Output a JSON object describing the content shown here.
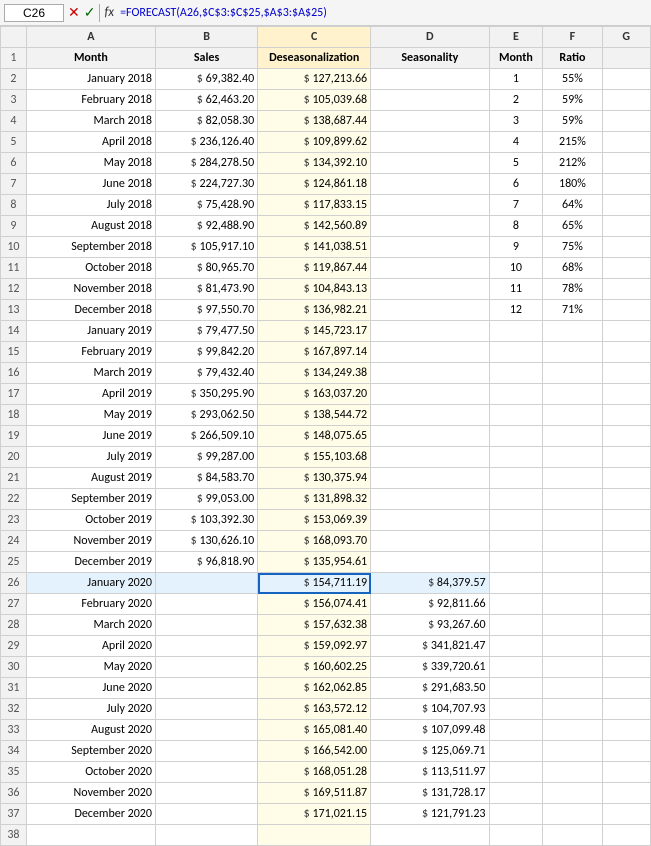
{
  "formulaBar": {
    "cellRef": "C26",
    "formula": "=FORECAST(A26,$C$3:$C$25,$A$3:$A$25)"
  },
  "columns": {
    "headers": [
      "",
      "A",
      "B",
      "C",
      "D",
      "E",
      "F",
      "G"
    ]
  },
  "rows": [
    {
      "rowNum": "1",
      "a": "Month",
      "b": "Sales",
      "c": "Deseasonalization",
      "d": "Seasonality",
      "e": "Month",
      "f": "Ratio",
      "g": ""
    },
    {
      "rowNum": "2",
      "a": "January 2018",
      "b_dollar": "$",
      "b_val": "69,382.40",
      "c_dollar": "$",
      "c_val": "127,213.66",
      "d": "",
      "e": "1",
      "f": "55%",
      "g": ""
    },
    {
      "rowNum": "3",
      "a": "February 2018",
      "b_dollar": "$",
      "b_val": "62,463.20",
      "c_dollar": "$",
      "c_val": "105,039.68",
      "d": "",
      "e": "2",
      "f": "59%",
      "g": ""
    },
    {
      "rowNum": "4",
      "a": "March 2018",
      "b_dollar": "$",
      "b_val": "82,058.30",
      "c_dollar": "$",
      "c_val": "138,687.44",
      "d": "",
      "e": "3",
      "f": "59%",
      "g": ""
    },
    {
      "rowNum": "5",
      "a": "April 2018",
      "b_dollar": "$",
      "b_val": "236,126.40",
      "c_dollar": "$",
      "c_val": "109,899.62",
      "d": "",
      "e": "4",
      "f": "215%",
      "g": ""
    },
    {
      "rowNum": "6",
      "a": "May 2018",
      "b_dollar": "$",
      "b_val": "284,278.50",
      "c_dollar": "$",
      "c_val": "134,392.10",
      "d": "",
      "e": "5",
      "f": "212%",
      "g": ""
    },
    {
      "rowNum": "7",
      "a": "June 2018",
      "b_dollar": "$",
      "b_val": "224,727.30",
      "c_dollar": "$",
      "c_val": "124,861.18",
      "d": "",
      "e": "6",
      "f": "180%",
      "g": ""
    },
    {
      "rowNum": "8",
      "a": "July 2018",
      "b_dollar": "$",
      "b_val": "75,428.90",
      "c_dollar": "$",
      "c_val": "117,833.15",
      "d": "",
      "e": "7",
      "f": "64%",
      "g": ""
    },
    {
      "rowNum": "9",
      "a": "August 2018",
      "b_dollar": "$",
      "b_val": "92,488.90",
      "c_dollar": "$",
      "c_val": "142,560.89",
      "d": "",
      "e": "8",
      "f": "65%",
      "g": ""
    },
    {
      "rowNum": "10",
      "a": "September 2018",
      "b_dollar": "$",
      "b_val": "105,917.10",
      "c_dollar": "$",
      "c_val": "141,038.51",
      "d": "",
      "e": "9",
      "f": "75%",
      "g": ""
    },
    {
      "rowNum": "11",
      "a": "October 2018",
      "b_dollar": "$",
      "b_val": "80,965.70",
      "c_dollar": "$",
      "c_val": "119,867.44",
      "d": "",
      "e": "10",
      "f": "68%",
      "g": ""
    },
    {
      "rowNum": "12",
      "a": "November 2018",
      "b_dollar": "$",
      "b_val": "81,473.90",
      "c_dollar": "$",
      "c_val": "104,843.13",
      "d": "",
      "e": "11",
      "f": "78%",
      "g": ""
    },
    {
      "rowNum": "13",
      "a": "December 2018",
      "b_dollar": "$",
      "b_val": "97,550.70",
      "c_dollar": "$",
      "c_val": "136,982.21",
      "d": "",
      "e": "12",
      "f": "71%",
      "g": ""
    },
    {
      "rowNum": "14",
      "a": "January 2019",
      "b_dollar": "$",
      "b_val": "79,477.50",
      "c_dollar": "$",
      "c_val": "145,723.17",
      "d": "",
      "e": "",
      "f": "",
      "g": ""
    },
    {
      "rowNum": "15",
      "a": "February 2019",
      "b_dollar": "$",
      "b_val": "99,842.20",
      "c_dollar": "$",
      "c_val": "167,897.14",
      "d": "",
      "e": "",
      "f": "",
      "g": ""
    },
    {
      "rowNum": "16",
      "a": "March 2019",
      "b_dollar": "$",
      "b_val": "79,432.40",
      "c_dollar": "$",
      "c_val": "134,249.38",
      "d": "",
      "e": "",
      "f": "",
      "g": ""
    },
    {
      "rowNum": "17",
      "a": "April 2019",
      "b_dollar": "$",
      "b_val": "350,295.90",
      "c_dollar": "$",
      "c_val": "163,037.20",
      "d": "",
      "e": "",
      "f": "",
      "g": ""
    },
    {
      "rowNum": "18",
      "a": "May 2019",
      "b_dollar": "$",
      "b_val": "293,062.50",
      "c_dollar": "$",
      "c_val": "138,544.72",
      "d": "",
      "e": "",
      "f": "",
      "g": ""
    },
    {
      "rowNum": "19",
      "a": "June 2019",
      "b_dollar": "$",
      "b_val": "266,509.10",
      "c_dollar": "$",
      "c_val": "148,075.65",
      "d": "",
      "e": "",
      "f": "",
      "g": ""
    },
    {
      "rowNum": "20",
      "a": "July 2019",
      "b_dollar": "$",
      "b_val": "99,287.00",
      "c_dollar": "$",
      "c_val": "155,103.68",
      "d": "",
      "e": "",
      "f": "",
      "g": ""
    },
    {
      "rowNum": "21",
      "a": "August 2019",
      "b_dollar": "$",
      "b_val": "84,583.70",
      "c_dollar": "$",
      "c_val": "130,375.94",
      "d": "",
      "e": "",
      "f": "",
      "g": ""
    },
    {
      "rowNum": "22",
      "a": "September 2019",
      "b_dollar": "$",
      "b_val": "99,053.00",
      "c_dollar": "$",
      "c_val": "131,898.32",
      "d": "",
      "e": "",
      "f": "",
      "g": ""
    },
    {
      "rowNum": "23",
      "a": "October 2019",
      "b_dollar": "$",
      "b_val": "103,392.30",
      "c_dollar": "$",
      "c_val": "153,069.39",
      "d": "",
      "e": "",
      "f": "",
      "g": ""
    },
    {
      "rowNum": "24",
      "a": "November 2019",
      "b_dollar": "$",
      "b_val": "130,626.10",
      "c_dollar": "$",
      "c_val": "168,093.70",
      "d": "",
      "e": "",
      "f": "",
      "g": ""
    },
    {
      "rowNum": "25",
      "a": "December 2019",
      "b_dollar": "$",
      "b_val": "96,818.90",
      "c_dollar": "$",
      "c_val": "135,954.61",
      "d": "",
      "e": "",
      "f": "",
      "g": ""
    },
    {
      "rowNum": "26",
      "a": "January 2020",
      "b_dollar": "",
      "b_val": "",
      "c_dollar": "$",
      "c_val": "154,711.19",
      "d_dollar": "$",
      "d_val": "84,379.57",
      "e": "",
      "f": "",
      "g": "",
      "activeC": true
    },
    {
      "rowNum": "27",
      "a": "February 2020",
      "b_dollar": "",
      "b_val": "",
      "c_dollar": "$",
      "c_val": "156,074.41",
      "d_dollar": "$",
      "d_val": "92,811.66",
      "e": "",
      "f": "",
      "g": ""
    },
    {
      "rowNum": "28",
      "a": "March 2020",
      "b_dollar": "",
      "b_val": "",
      "c_dollar": "$",
      "c_val": "157,632.38",
      "d_dollar": "$",
      "d_val": "93,267.60",
      "e": "",
      "f": "",
      "g": ""
    },
    {
      "rowNum": "29",
      "a": "April 2020",
      "b_dollar": "",
      "b_val": "",
      "c_dollar": "$",
      "c_val": "159,092.97",
      "d_dollar": "$",
      "d_val": "341,821.47",
      "e": "",
      "f": "",
      "g": ""
    },
    {
      "rowNum": "30",
      "a": "May 2020",
      "b_dollar": "",
      "b_val": "",
      "c_dollar": "$",
      "c_val": "160,602.25",
      "d_dollar": "$",
      "d_val": "339,720.61",
      "e": "",
      "f": "",
      "g": ""
    },
    {
      "rowNum": "31",
      "a": "June 2020",
      "b_dollar": "",
      "b_val": "",
      "c_dollar": "$",
      "c_val": "162,062.85",
      "d_dollar": "$",
      "d_val": "291,683.50",
      "e": "",
      "f": "",
      "g": ""
    },
    {
      "rowNum": "32",
      "a": "July 2020",
      "b_dollar": "",
      "b_val": "",
      "c_dollar": "$",
      "c_val": "163,572.12",
      "d_dollar": "$",
      "d_val": "104,707.93",
      "e": "",
      "f": "",
      "g": ""
    },
    {
      "rowNum": "33",
      "a": "August 2020",
      "b_dollar": "",
      "b_val": "",
      "c_dollar": "$",
      "c_val": "165,081.40",
      "d_dollar": "$",
      "d_val": "107,099.48",
      "e": "",
      "f": "",
      "g": ""
    },
    {
      "rowNum": "34",
      "a": "September 2020",
      "b_dollar": "",
      "b_val": "",
      "c_dollar": "$",
      "c_val": "166,542.00",
      "d_dollar": "$",
      "d_val": "125,069.71",
      "e": "",
      "f": "",
      "g": ""
    },
    {
      "rowNum": "35",
      "a": "October 2020",
      "b_dollar": "",
      "b_val": "",
      "c_dollar": "$",
      "c_val": "168,051.28",
      "d_dollar": "$",
      "d_val": "113,511.97",
      "e": "",
      "f": "",
      "g": ""
    },
    {
      "rowNum": "36",
      "a": "November 2020",
      "b_dollar": "",
      "b_val": "",
      "c_dollar": "$",
      "c_val": "169,511.87",
      "d_dollar": "$",
      "d_val": "131,728.17",
      "e": "",
      "f": "",
      "g": ""
    },
    {
      "rowNum": "37",
      "a": "December 2020",
      "b_dollar": "",
      "b_val": "",
      "c_dollar": "$",
      "c_val": "171,021.15",
      "d_dollar": "$",
      "d_val": "121,791.23",
      "e": "",
      "f": "",
      "g": ""
    },
    {
      "rowNum": "38",
      "a": "",
      "b_dollar": "",
      "b_val": "",
      "c_dollar": "",
      "c_val": "",
      "d_dollar": "",
      "d_val": "",
      "e": "",
      "f": "",
      "g": ""
    }
  ]
}
